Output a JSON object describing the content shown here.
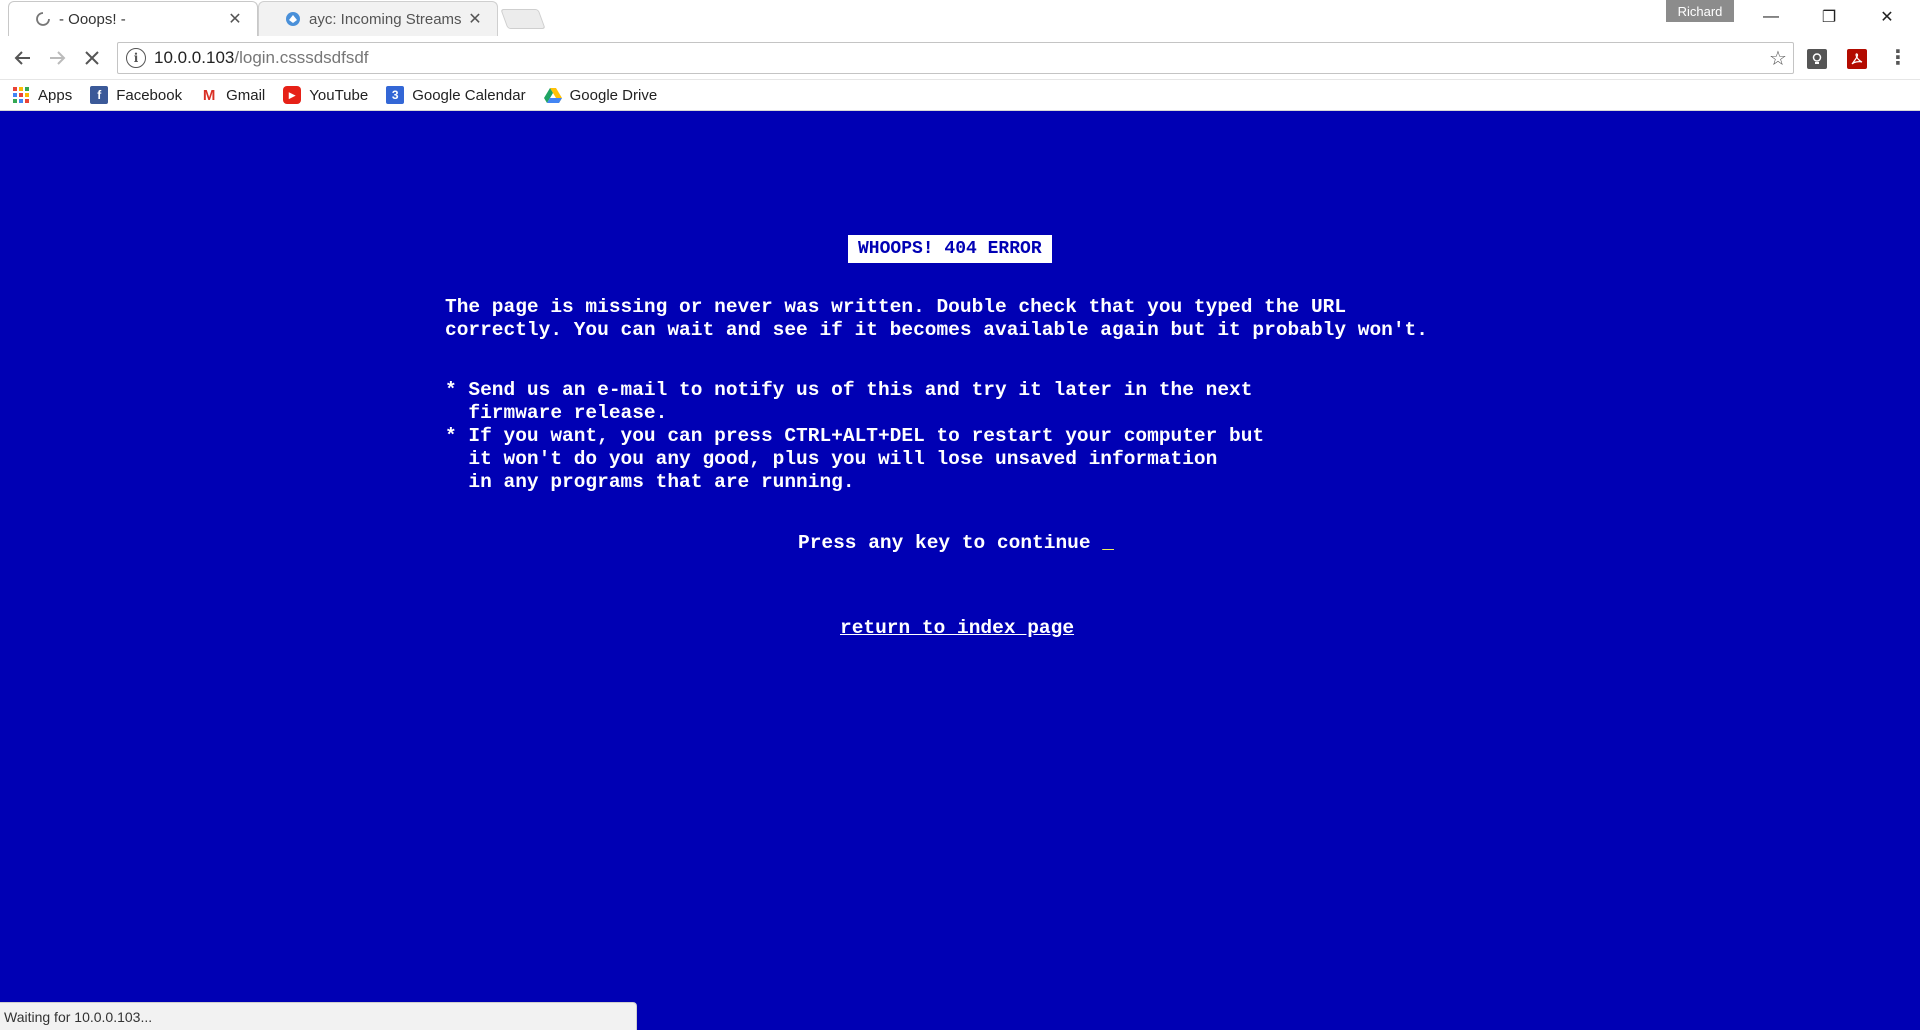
{
  "browser": {
    "tabs": [
      {
        "title": "- Ooops! -",
        "state": "loading",
        "active": true
      },
      {
        "title": "ayc: Incoming Streams | \\",
        "active": false
      }
    ],
    "profile_name": "Richard",
    "window_controls": {
      "minimize": "—",
      "restore": "❐",
      "close": "✕"
    }
  },
  "toolbar": {
    "url_host": "10.0.0.103",
    "url_path": "/login.csssdsdfsdf",
    "info_icon": "i",
    "star_icon": "☆",
    "extensions": [
      "lightbulb-extension",
      "adobe-acrobat-extension"
    ],
    "menu": "⋮"
  },
  "bookmarks": [
    {
      "label": "Apps",
      "icon": "apps-grid-icon"
    },
    {
      "label": "Facebook",
      "icon": "facebook-icon",
      "color": "#3b5998",
      "glyph": "f"
    },
    {
      "label": "Gmail",
      "icon": "gmail-icon",
      "color": "#d93025",
      "glyph": "M"
    },
    {
      "label": "YouTube",
      "icon": "youtube-icon",
      "color": "#e62117",
      "glyph": "▶"
    },
    {
      "label": "Google Calendar",
      "icon": "google-calendar-icon",
      "color": "#3367d6",
      "glyph": "3"
    },
    {
      "label": "Google Drive",
      "icon": "google-drive-icon",
      "color": "#1fa463",
      "glyph": "▲"
    }
  ],
  "page": {
    "background": "#0000b4",
    "title": "WHOOPS! 404 ERROR",
    "description": "The page is missing or never was written. Double check that you typed the URL\ncorrectly. You can wait and see if it becomes available again but it probably won't.",
    "bullets": "* Send us an e-mail to notify us of this and try it later in the next\n  firmware release.\n* If you want, you can press CTRL+ALT+DEL to restart your computer but\n  it won't do you any good, plus you will lose unsaved information\n  in any programs that are running.",
    "press_prompt": "Press any key to continue ",
    "cursor": "_",
    "return_link": "return to index page"
  },
  "status": {
    "text": "Waiting for 10.0.0.103..."
  }
}
